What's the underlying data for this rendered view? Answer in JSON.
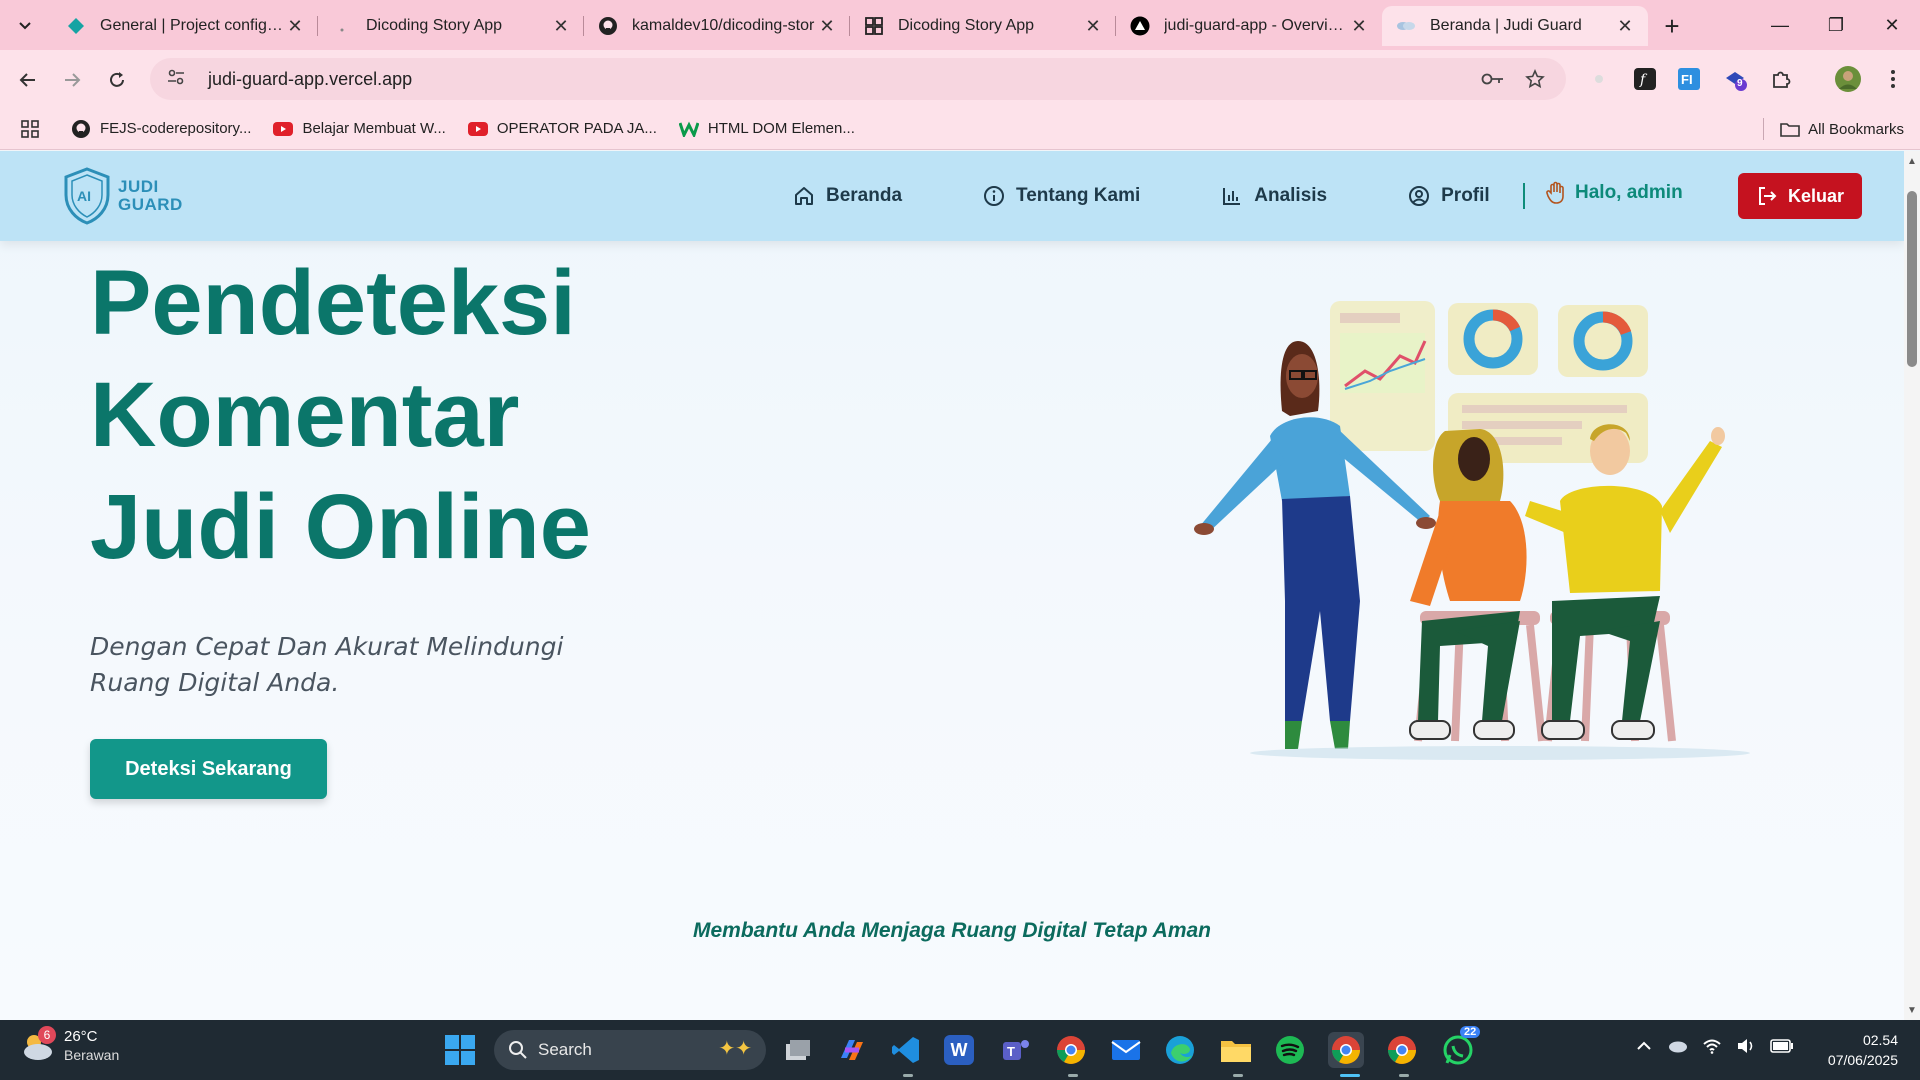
{
  "browser": {
    "tabs": [
      {
        "title": "General | Project configura",
        "icon": "diamond-icon",
        "color": "#16a3a3"
      },
      {
        "title": "Dicoding Story App",
        "icon": "blank-page-icon",
        "color": "#999999"
      },
      {
        "title": "kamaldev10/dicoding-stor",
        "icon": "github-icon",
        "color": "#222222"
      },
      {
        "title": "Dicoding Story App",
        "icon": "grid-icon",
        "color": "#222222"
      },
      {
        "title": "judi-guard-app - Overview",
        "icon": "vercel-icon",
        "color": "#000000"
      },
      {
        "title": "Beranda | Judi Guard",
        "icon": "judi-guard-favicon",
        "color": "#8fb0d0",
        "active": true
      }
    ],
    "url": "judi-guard-app.vercel.app",
    "bookmarks": [
      {
        "label": "FEJS-coderepository...",
        "icon": "github-icon"
      },
      {
        "label": "Belajar Membuat W...",
        "icon": "youtube-icon"
      },
      {
        "label": "OPERATOR PADA JA...",
        "icon": "youtube-icon"
      },
      {
        "label": "HTML DOM Elemen...",
        "icon": "w3schools-icon"
      }
    ],
    "all_bookmarks": "All Bookmarks",
    "extension_badge": "9"
  },
  "site": {
    "logo_line1": "JUDI",
    "logo_line2": "GUARD",
    "logo_badge": "AI",
    "nav": [
      {
        "label": "Beranda",
        "icon": "home-icon"
      },
      {
        "label": "Tentang Kami",
        "icon": "info-icon"
      },
      {
        "label": "Analisis",
        "icon": "bar-chart-icon"
      },
      {
        "label": "Profil",
        "icon": "user-circle-icon"
      }
    ],
    "greeting": "Halo, admin",
    "logout_label": "Keluar",
    "hero": {
      "title_lines": [
        "Pendeteksi",
        "Komentar",
        "Judi Online"
      ],
      "subtitle": "Dengan Cepat Dan Akurat Melindungi Ruang Digital Anda.",
      "cta_label": "Deteksi Sekarang"
    },
    "tagline": "Membantu Anda Menjaga Ruang Digital Tetap Aman",
    "colors": {
      "primary": "#0b766a",
      "header_bg": "#bde3f6",
      "logout_bg": "#c5121f",
      "cta_bg": "#12978a"
    }
  },
  "taskbar": {
    "weather_temp": "26°C",
    "weather_desc": "Berawan",
    "weather_badge": "6",
    "search_label": "Search",
    "whatsapp_badge": "22",
    "time": "02.54",
    "date": "07/06/2025"
  }
}
